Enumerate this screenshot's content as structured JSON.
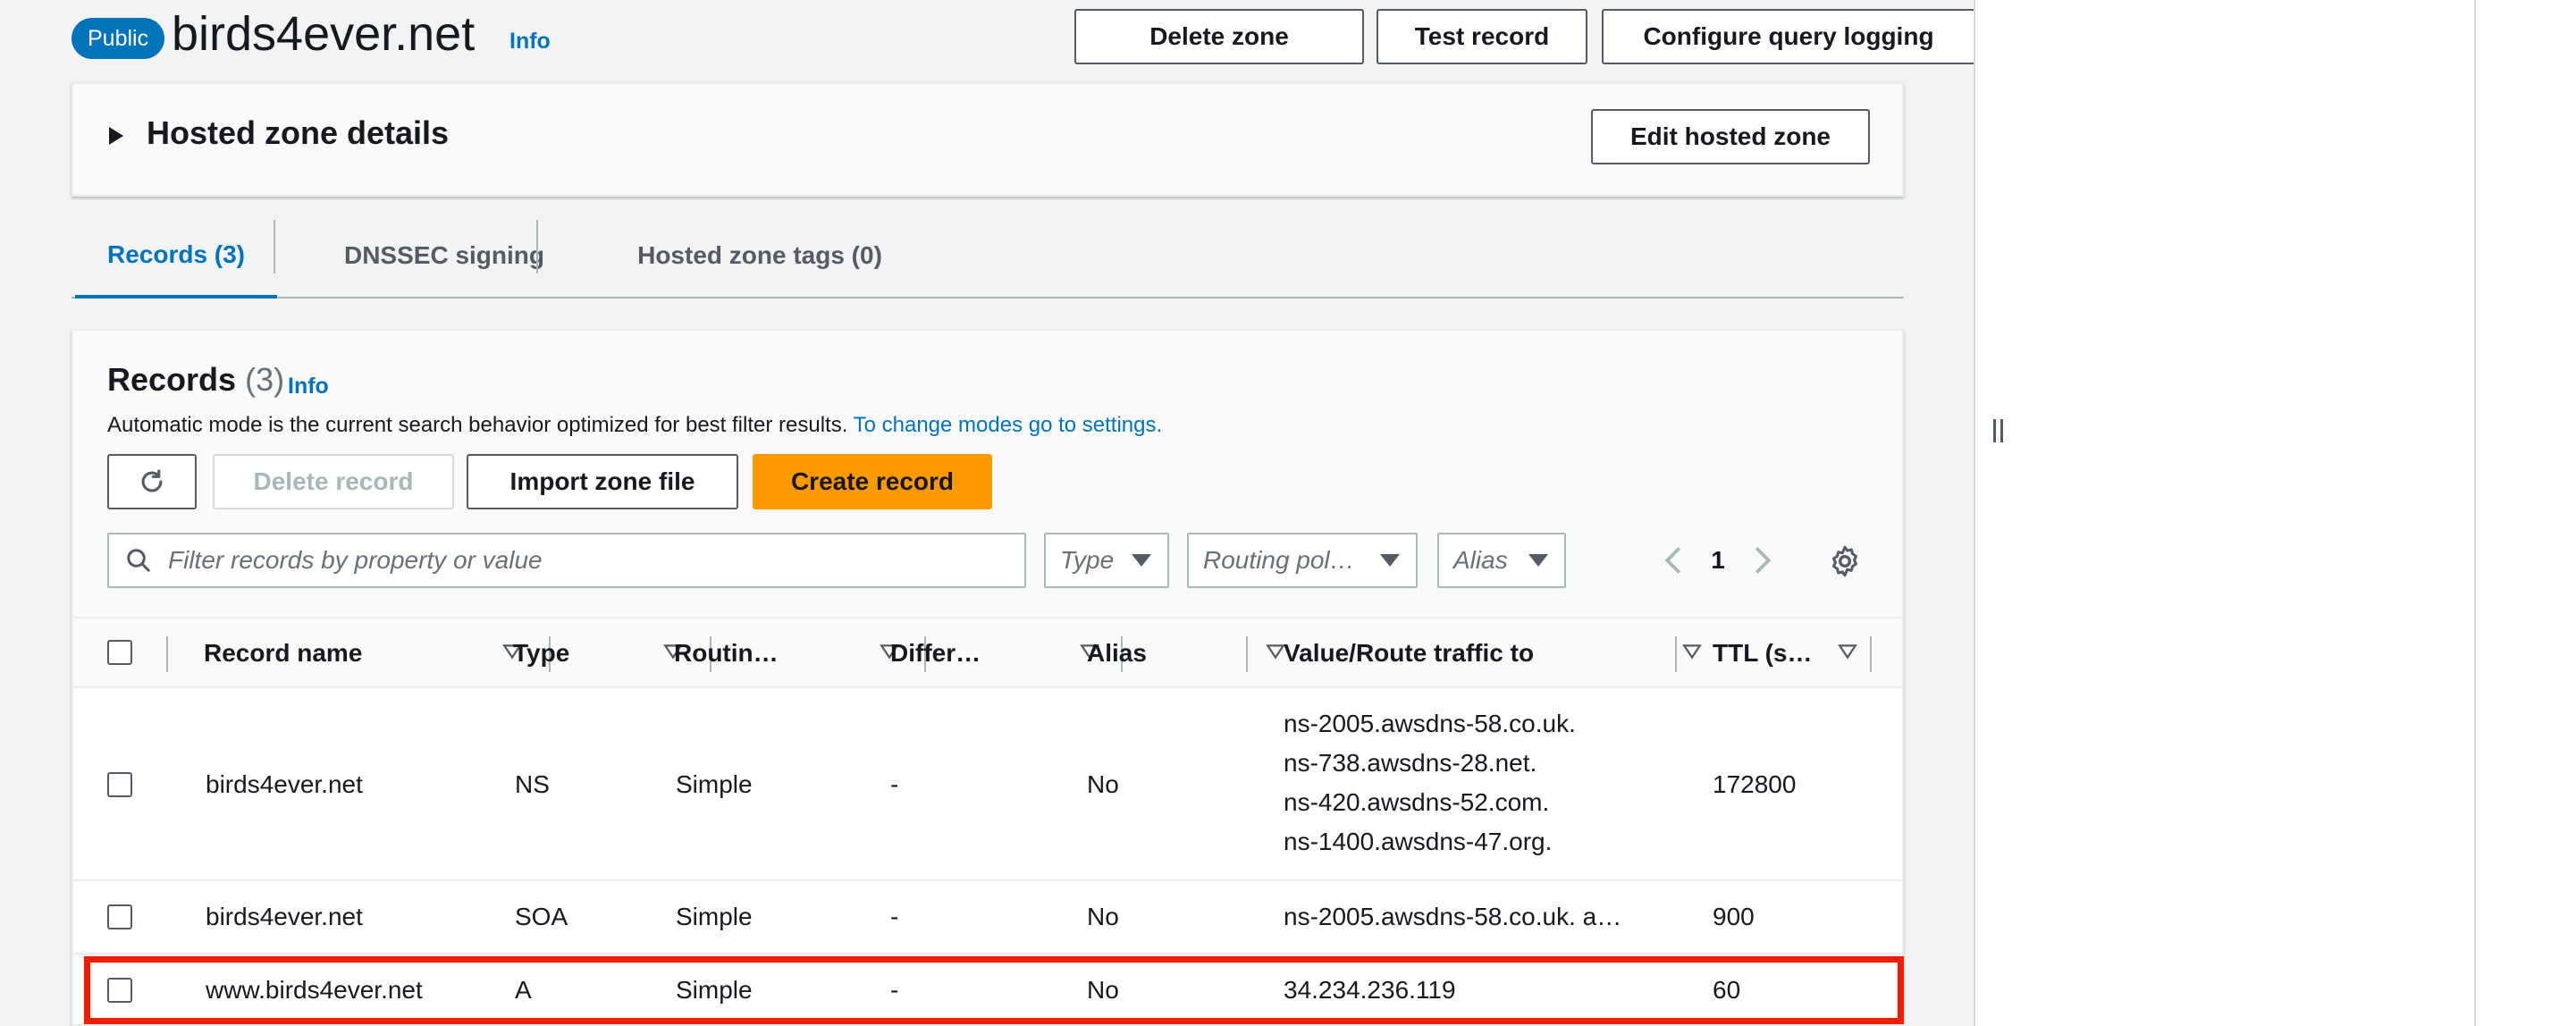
{
  "zone": {
    "badge": "Public",
    "name": "birds4ever.net",
    "info": "Info",
    "actions": {
      "delete": "Delete zone",
      "test": "Test record",
      "query_logging": "Configure query logging"
    }
  },
  "details": {
    "title": "Hosted zone details",
    "edit": "Edit hosted zone"
  },
  "tabs": [
    {
      "label": "Records (3)",
      "active": true
    },
    {
      "label": "DNSSEC signing"
    },
    {
      "label": "Hosted zone tags (0)"
    }
  ],
  "records": {
    "title": "Records",
    "count": "(3)",
    "info": "Info",
    "description": "Automatic mode is the current search behavior optimized for best filter results.",
    "description_link": "To change modes go to settings.",
    "buttons": {
      "delete": "Delete record",
      "import": "Import zone file",
      "create": "Create record"
    },
    "search_placeholder": "Filter records by property or value",
    "filters": {
      "type": "Type",
      "routing": "Routing pol…",
      "alias": "Alias"
    },
    "page": "1",
    "columns": [
      "Record name",
      "Type",
      "Routin…",
      "Differ…",
      "Alias",
      "Value/Route traffic to",
      "TTL (s…"
    ],
    "rows": [
      {
        "name": "birds4ever.net",
        "type": "NS",
        "routing": "Simple",
        "differ": "-",
        "alias": "No",
        "values": [
          "ns-2005.awsdns-58.co.uk.",
          "ns-738.awsdns-28.net.",
          "ns-420.awsdns-52.com.",
          "ns-1400.awsdns-47.org."
        ],
        "ttl": "172800"
      },
      {
        "name": "birds4ever.net",
        "type": "SOA",
        "routing": "Simple",
        "differ": "-",
        "alias": "No",
        "values": [
          "ns-2005.awsdns-58.co.uk. a…"
        ],
        "ttl": "900"
      },
      {
        "name": "www.birds4ever.net",
        "type": "A",
        "routing": "Simple",
        "differ": "-",
        "alias": "No",
        "values": [
          "34.234.236.119"
        ],
        "ttl": "60",
        "highlighted": true
      }
    ]
  },
  "colors": {
    "accent": "#0073bb",
    "primary_button": "#ff9900",
    "highlight": "#f21c00"
  }
}
